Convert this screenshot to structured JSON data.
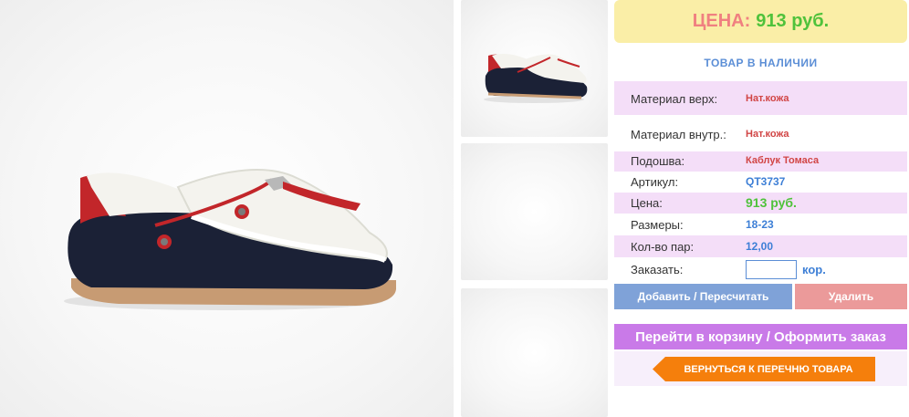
{
  "price": {
    "label": "ЦЕНА:",
    "value": "913 руб."
  },
  "stock": "ТОВАР В НАЛИЧИИ",
  "specs": [
    {
      "label": "Материал верх:",
      "value": "Нат.кожа"
    },
    {
      "label": "Материал внутр.:",
      "value": "Нат.кожа"
    },
    {
      "label": "Подошва:",
      "value": "Каблук Томаса"
    },
    {
      "label": "Артикул:",
      "value": "QT3737"
    },
    {
      "label": "Цена:",
      "value": "913 руб."
    },
    {
      "label": "Размеры:",
      "value": "18-23"
    },
    {
      "label": "Кол-во пар:",
      "value": "12,00"
    }
  ],
  "order": {
    "label": "Заказать:",
    "value": "",
    "unit": "кор."
  },
  "buttons": {
    "add": "Добавить / Пересчитать",
    "delete": "Удалить",
    "cart": "Перейти в корзину / Оформить заказ",
    "back": "ВЕРНУТЬСЯ К ПЕРЕЧНЮ ТОВАРА"
  },
  "colors": {
    "price_label": "#f08080",
    "price_value": "#4fc23b",
    "add_button": "#7fa2d8",
    "delete_button": "#eb9a9a",
    "cart_button": "#c97ae8",
    "back_button": "#f57f0c"
  },
  "icons": {
    "product": "moccasin-shoe-image"
  }
}
